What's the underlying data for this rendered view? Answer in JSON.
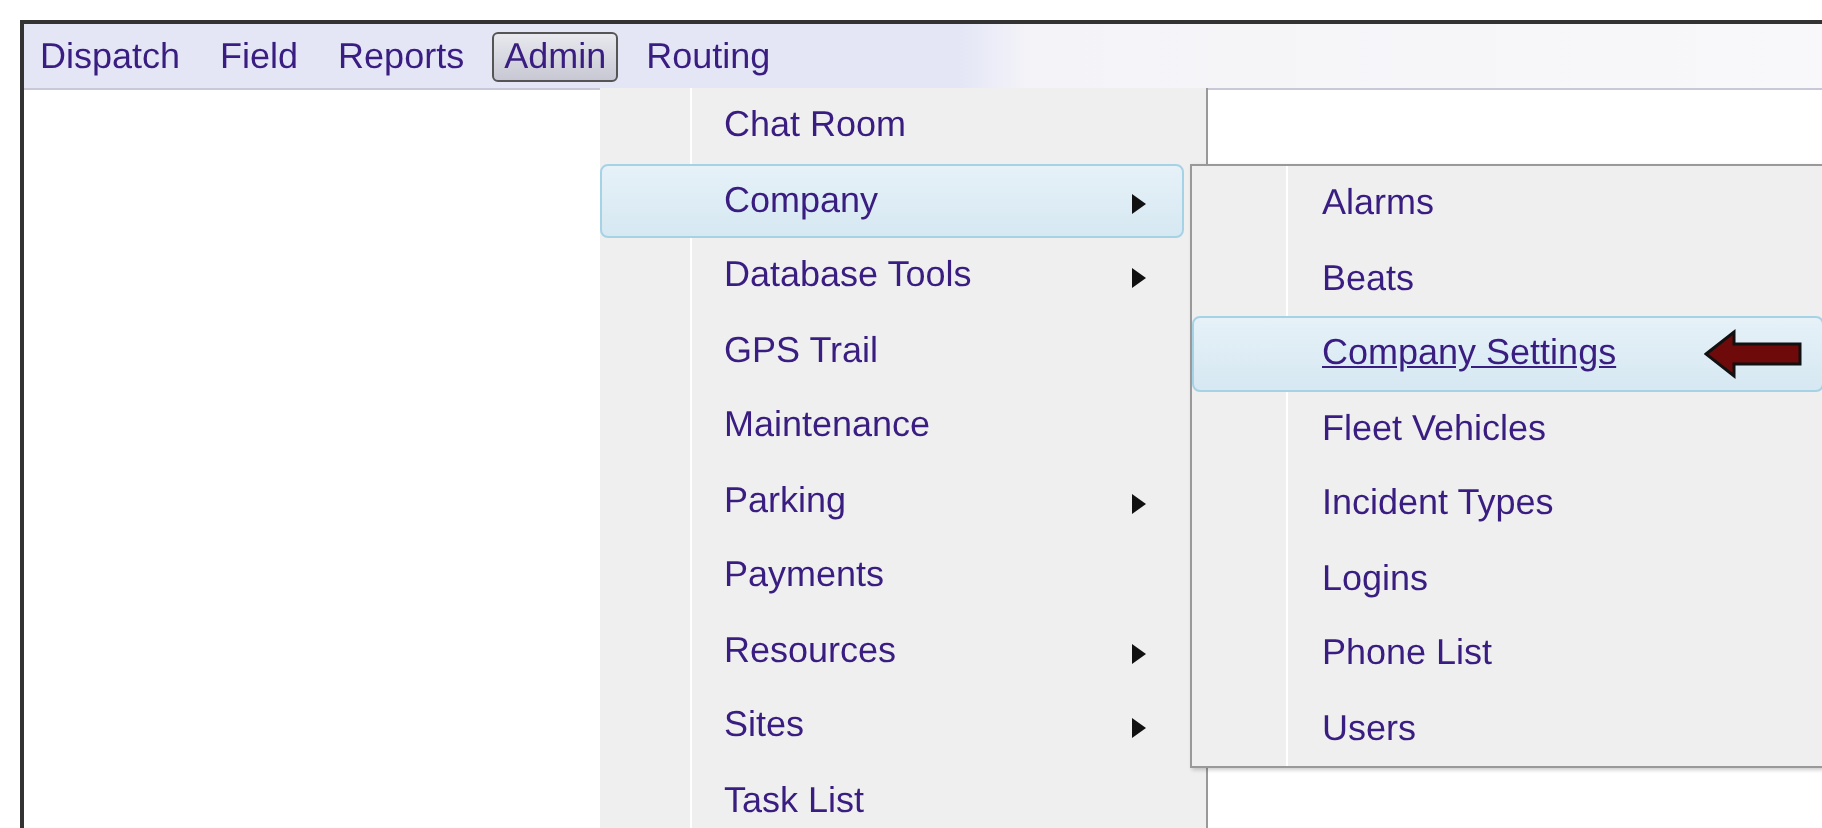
{
  "menubar": [
    {
      "label": "Dispatch",
      "selected": false
    },
    {
      "label": "Field",
      "selected": false
    },
    {
      "label": "Reports",
      "selected": false
    },
    {
      "label": "Admin",
      "selected": true
    },
    {
      "label": "Routing",
      "selected": false
    }
  ],
  "menu": [
    {
      "label": "Chat Room",
      "selected": false,
      "has_submenu": false
    },
    {
      "label": "Company",
      "selected": true,
      "has_submenu": true
    },
    {
      "label": "Database Tools",
      "selected": false,
      "has_submenu": true
    },
    {
      "label": "GPS Trail",
      "selected": false,
      "has_submenu": false
    },
    {
      "label": "Maintenance",
      "selected": false,
      "has_submenu": false
    },
    {
      "label": "Parking",
      "selected": false,
      "has_submenu": true
    },
    {
      "label": "Payments",
      "selected": false,
      "has_submenu": false
    },
    {
      "label": "Resources",
      "selected": false,
      "has_submenu": true
    },
    {
      "label": "Sites",
      "selected": false,
      "has_submenu": true
    },
    {
      "label": "Task List",
      "selected": false,
      "has_submenu": false
    }
  ],
  "submenu": [
    {
      "label": "Alarms",
      "selected": false
    },
    {
      "label": "Beats",
      "selected": false
    },
    {
      "label": "Company Settings",
      "selected": true
    },
    {
      "label": "Fleet Vehicles",
      "selected": false
    },
    {
      "label": "Incident Types",
      "selected": false
    },
    {
      "label": "Logins",
      "selected": false
    },
    {
      "label": "Phone List",
      "selected": false
    },
    {
      "label": "Users",
      "selected": false
    }
  ]
}
